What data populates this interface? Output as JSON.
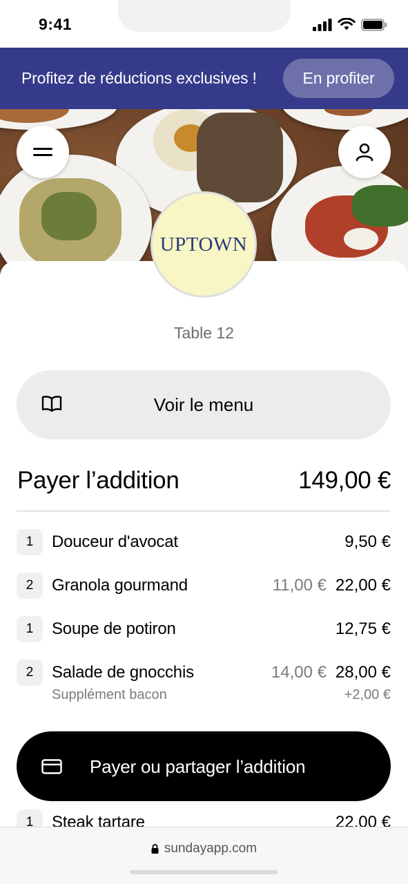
{
  "status_bar": {
    "time": "9:41",
    "icons": [
      "signal-icon",
      "wifi-icon",
      "battery-icon"
    ]
  },
  "promo": {
    "text": "Profitez de réductions exclusives !",
    "button_label": "En profiter",
    "background": "#363a8a"
  },
  "header": {
    "menu_icon": "hamburger-icon",
    "account_icon": "user-icon"
  },
  "restaurant": {
    "logo_text": "UPTOWN",
    "logo_background": "#f8f6c4",
    "table_label": "Table 12"
  },
  "menu_button": {
    "label": "Voir le menu",
    "icon": "book-icon"
  },
  "bill": {
    "title": "Payer l’addition",
    "total": "149,00 €",
    "items": [
      {
        "qty": "1",
        "name": "Douceur d'avocat",
        "unit_price": "",
        "price": "9,50 €"
      },
      {
        "qty": "2",
        "name": "Granola gourmand",
        "unit_price": "11,00 €",
        "price": "22,00 €"
      },
      {
        "qty": "1",
        "name": "Soupe de potiron",
        "unit_price": "",
        "price": "12,75 €"
      },
      {
        "qty": "2",
        "name": "Salade de gnocchis",
        "unit_price": "14,00 €",
        "price": "28,00 €",
        "extra": {
          "name": "Supplément bacon",
          "price": "+2,00 €"
        }
      },
      {
        "qty": "1",
        "name": "Steak tartare",
        "unit_price": "",
        "price": "22,00 €"
      }
    ]
  },
  "pay_button": {
    "label": "Payer ou partager l’addition",
    "icon": "credit-card-icon"
  },
  "browser": {
    "url": "sundayapp.com",
    "lock_icon": "lock-icon"
  }
}
